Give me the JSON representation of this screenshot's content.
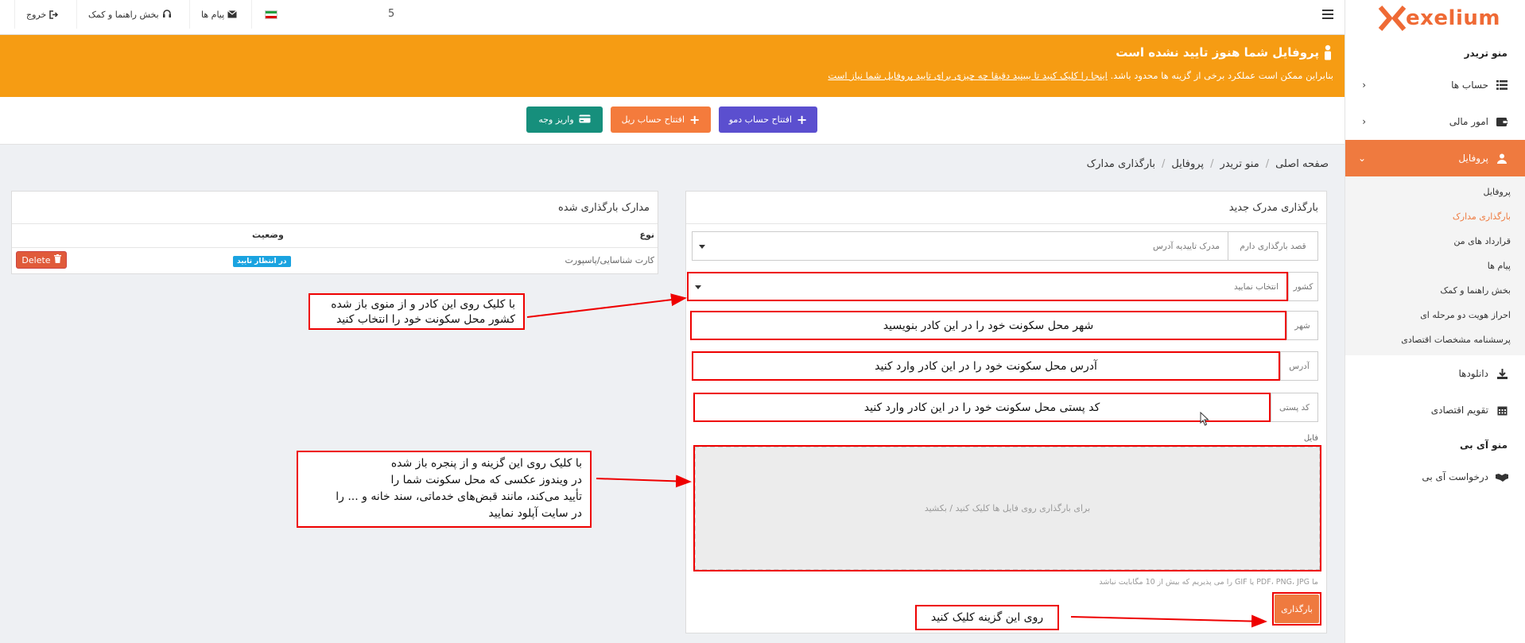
{
  "brand": {
    "name": "exelium",
    "color": "#ef6a35"
  },
  "topbar": {
    "count": "5",
    "messages": "پیام ها",
    "help": "بخش راهنما و کمک",
    "logout": "خروج"
  },
  "banner": {
    "title": "پروفایل شما هنوز تایید نشده است",
    "text_before": "بنابراین ممکن است عملکرد برخی از گزینه ها محدود باشد.",
    "link_text": "اینجا را کلیک کنید تا ببینید دقیقا چه چیزی برای تایید پروفایل شما نیاز است",
    "color": "#f69c13"
  },
  "actions": {
    "demo": "افتتاح حساب دمو",
    "real": "افتتاح حساب ریل",
    "deposit": "واریز وجه"
  },
  "breadcrumb": [
    "صفحه اصلی",
    "منو تریدر",
    "پروفایل",
    "بارگذاری مدارک"
  ],
  "sidebar": {
    "trader_menu_title": "منو تریدر",
    "items": {
      "accounts": "حساب ها",
      "finance": "امور مالی",
      "profile": "پروفایل",
      "downloads": "دانلودها",
      "calendar": "تقویم اقتصادی"
    },
    "profile_sub": [
      "پروفایل",
      "بارگذاری مدارک",
      "قرارداد های من",
      "پیام ها",
      "بخش راهنما و کمک",
      "احراز هویت دو مرحله ای",
      "پرسشنامه مشخصات اقتصادی"
    ],
    "ib_menu_title": "منو آی بی",
    "ib_request": "درخواست آی بی"
  },
  "upload_form": {
    "title": "بارگذاری مدرک جدید",
    "intent_label": "قصد بارگذاری دارم",
    "intent_value": "مدرک تاییدیه آدرس",
    "country_label": "کشور",
    "country_placeholder": "انتخاب نمایید",
    "city_label": "شهر",
    "city_overlay": "شهر محل سکونت خود را در این کادر بنویسید",
    "address_label": "آدرس",
    "address_overlay": "آدرس محل سکونت خود را در این کادر وارد کنید",
    "postal_label": "کد پستی",
    "postal_overlay": "کد پستی محل سکونت خود را در این کادر وارد کنید",
    "file_label": "فایل",
    "dropzone_text": "برای بارگذاری روی فایل ها کلیک کنید / بکشید",
    "file_hint": "ما PDF، PNG، JPG یا GIF را می پذیریم که بیش از 10 مگابایت نباشد",
    "submit": "بارگذاری"
  },
  "uploaded": {
    "title": "مدارک بارگذاری شده",
    "col_type": "نوع",
    "col_status": "وضعیت",
    "rows": [
      {
        "type": "کارت شناسایی/پاسپورت",
        "status": "در انتظار تایید",
        "delete": "Delete"
      }
    ]
  },
  "annotations": {
    "country_note": "با کلیک روی این کادر و از منوی باز شده\nکشور محل سکونت خود را انتخاب کنید",
    "file_note": "با کلیک روی این گزینه و از پنجره باز شده\nدر ویندوز عکسی که محل سکونت شما را\nتأیید می‌کند، مانند قبض‌های خدماتی، سند خانه و ... را\nدر سایت آپلود نمایید",
    "submit_note": "روی این گزینه کلیک کنید"
  },
  "colors": {
    "accent": "#ef7a3f",
    "demo_button": "#5b4fcf",
    "real_button": "#f47b3c",
    "deposit_button": "#168f7c",
    "annotation": "#e00000",
    "badge": "#1aa3e0"
  }
}
